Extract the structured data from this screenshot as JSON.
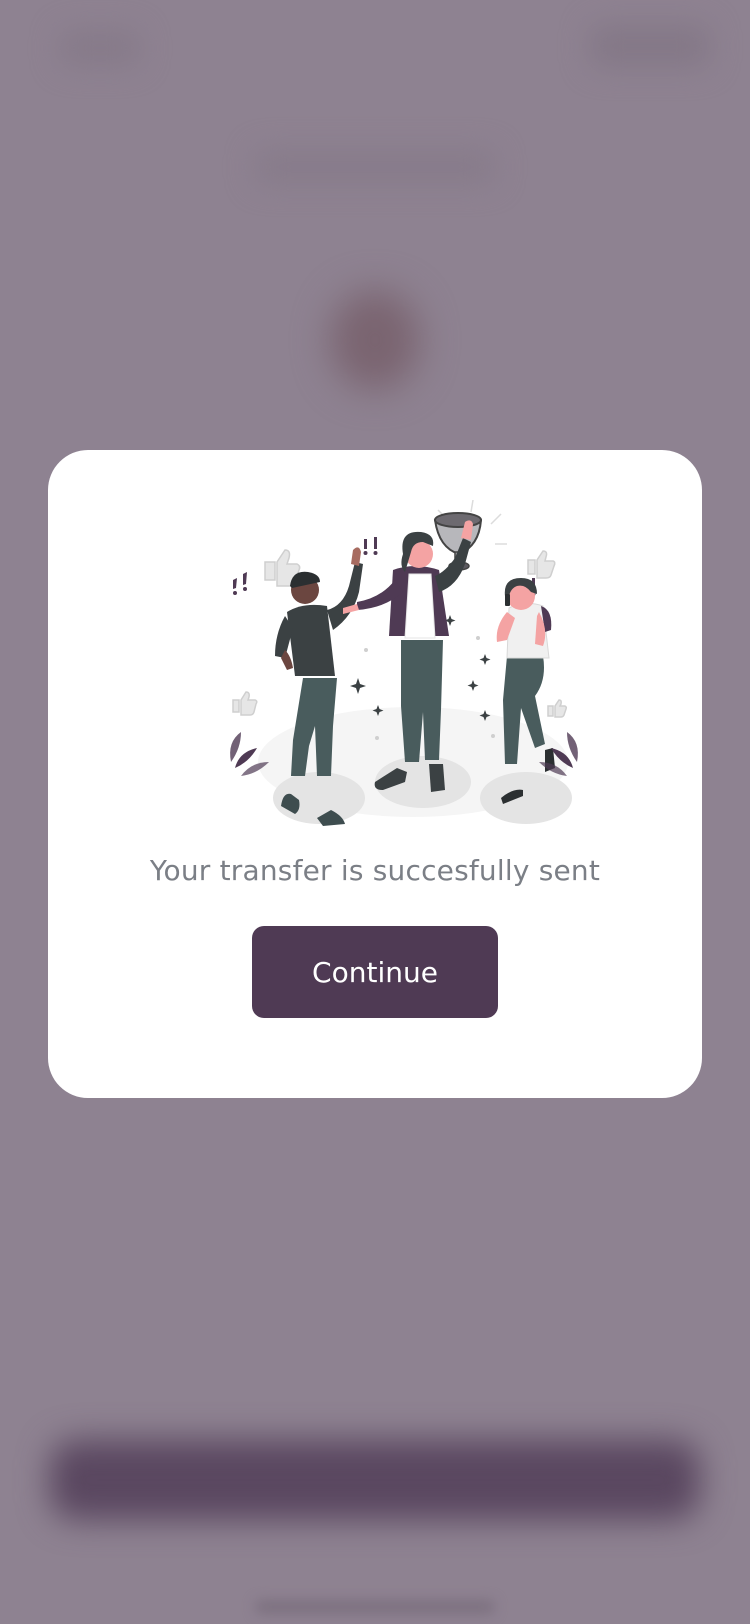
{
  "modal": {
    "message": "Your transfer is succesfully sent",
    "continue_label": "Continue"
  },
  "colors": {
    "overlay": "#8e8291",
    "modal_background": "#ffffff",
    "button_background": "#4f3a54",
    "button_text": "#ffffff",
    "message_text": "#7b7f86"
  },
  "illustration": {
    "icon": "celebration-illustration"
  }
}
